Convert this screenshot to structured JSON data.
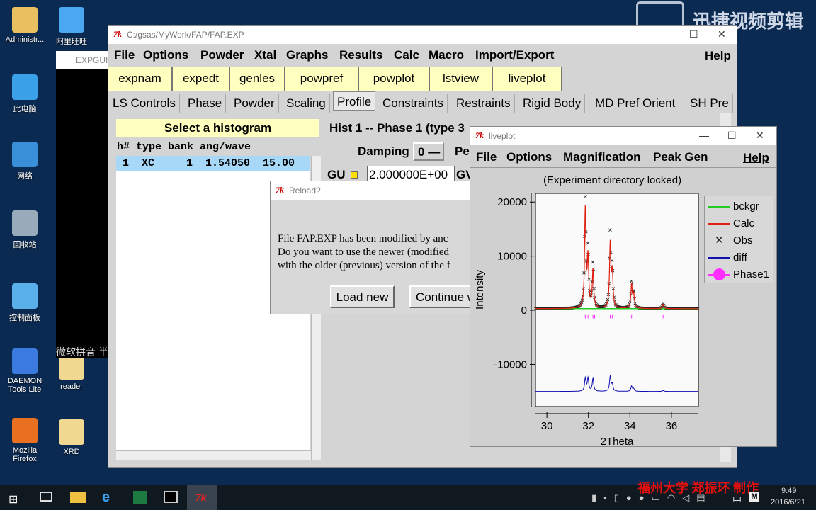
{
  "desktop": {
    "icons": [
      {
        "label": "Administr...",
        "color": "#e8c060"
      },
      {
        "label": "阿里旺旺",
        "color": "#4aa8f0"
      },
      {
        "label": "此电脑",
        "color": "#3aa0e8"
      },
      {
        "label": "网络",
        "color": "#3a90d8"
      },
      {
        "label": "回收站",
        "color": "#9ab"
      },
      {
        "label": "控制面板",
        "color": "#5ab0e8"
      },
      {
        "label": "DAEMON Tools Lite",
        "color": "#3b7be0"
      },
      {
        "label": "reader",
        "color": "#f0d890"
      },
      {
        "label": "Mozilla Firefox",
        "color": "#e87020"
      },
      {
        "label": "XRD",
        "color": "#f0d890"
      }
    ],
    "watermark": "迅捷视频剪辑",
    "credit": "福州大学 郑振环 制作",
    "ime_text": "微软拼音 半"
  },
  "expgui_console": {
    "title": "EXPGUI"
  },
  "main": {
    "title": "C:/gsas/MyWork/FAP/FAP.EXP",
    "menu": [
      "File",
      "Options",
      "Powder",
      "Xtal",
      "Graphs",
      "Results",
      "Calc",
      "Macro",
      "Import/Export"
    ],
    "help": "Help",
    "buttons": [
      "expnam",
      "expedt",
      "genles",
      "powpref",
      "powplot",
      "lstview",
      "liveplot"
    ],
    "tabs": [
      "LS Controls",
      "Phase",
      "Powder",
      "Scaling",
      "Profile",
      "Constraints",
      "Restraints",
      "Rigid Body",
      "MD Pref Orient",
      "SH Pre"
    ],
    "selected_tab": "Profile",
    "hist_header": "Select a histogram",
    "hist_columns": "h# type bank ang/wave",
    "hist_rows": [
      {
        "text": " 1  XC     1  1.54050  15.00"
      }
    ],
    "profile_title": "Hist 1 -- Phase 1 (type 3",
    "damping_label": "Damping",
    "damping_value": "0",
    "pe_label": "Pe",
    "gu_label": "GU",
    "gu_value": "2.000000E+00",
    "gv_label": "GV"
  },
  "dialog": {
    "title": "Reload?",
    "lines": [
      "File FAP.EXP has been modified by anc",
      "Do you want to use the newer (modified",
      "with the older (previous) version of the f"
    ],
    "load_button": "Load new",
    "continue_button": "Continue w"
  },
  "liveplot": {
    "title": "liveplot",
    "menu": [
      "File",
      "Options",
      "Magnification",
      "Peak Gen"
    ],
    "help": "Help",
    "status": "(Experiment directory locked)"
  },
  "chart_data": {
    "type": "line",
    "xlabel": "2Theta",
    "ylabel": "Intensity",
    "xlim": [
      29.45,
      37.3
    ],
    "ylim": [
      -17800,
      21600
    ],
    "xticks": [
      30,
      32,
      34,
      36
    ],
    "yticks": [
      20000,
      10000,
      0,
      -10000
    ],
    "legend": [
      "bckgr",
      "Calc",
      "Obs",
      "diff",
      "Phase1"
    ],
    "legend_placement": "right",
    "colors": {
      "bckgr": "#22cc22",
      "Calc": "#e02010",
      "Obs": "#222222",
      "diff": "#1010b0",
      "Phase1": "#ff30ff"
    },
    "background_level": 300,
    "diff_offset": -15000,
    "peaks": [
      {
        "x": 31.85,
        "obs": 19700,
        "calc": 18200
      },
      {
        "x": 31.98,
        "obs": 10500,
        "calc": 9000
      },
      {
        "x": 32.22,
        "obs": 8500,
        "calc": 7000
      },
      {
        "x": 33.05,
        "obs": 13500,
        "calc": 11800
      },
      {
        "x": 33.15,
        "obs": 7000,
        "calc": 6200
      },
      {
        "x": 34.08,
        "obs": 5000,
        "calc": 4400
      },
      {
        "x": 34.18,
        "obs": 2800,
        "calc": 2500
      },
      {
        "x": 35.6,
        "obs": 900,
        "calc": 800
      }
    ],
    "reflections": [
      31.85,
      31.98,
      32.22,
      32.3,
      33.05,
      33.15,
      34.08,
      35.6
    ]
  },
  "taskbar": {
    "time": "9:49",
    "date": "2016/6/21",
    "ime": "中"
  }
}
